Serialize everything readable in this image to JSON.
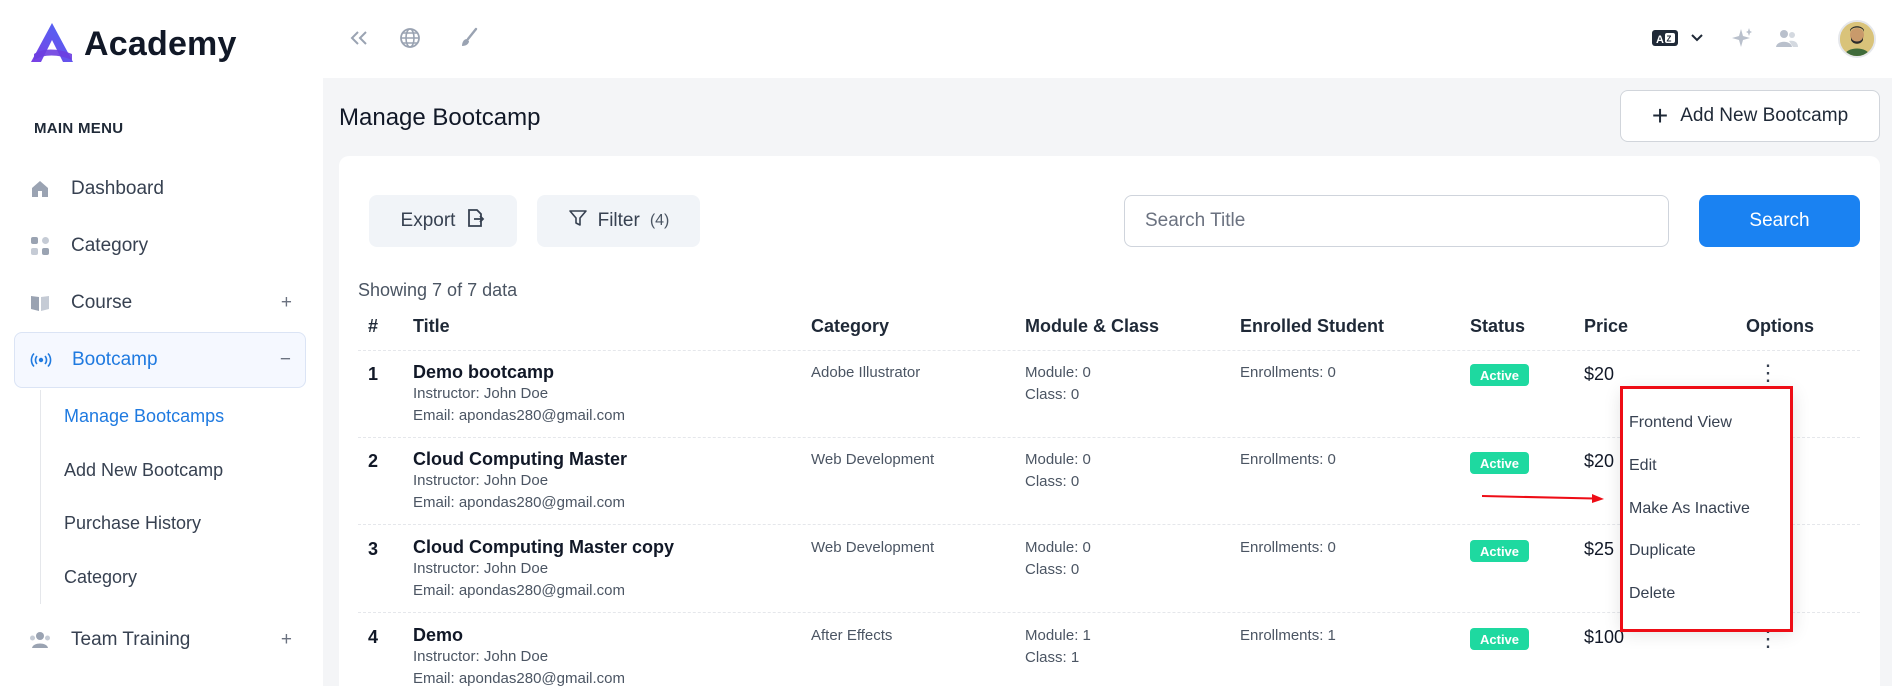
{
  "brand": {
    "name": "Academy"
  },
  "sidebar": {
    "section_label": "MAIN MENU",
    "items": [
      {
        "label": "Dashboard",
        "icon": "home-icon",
        "toggle": ""
      },
      {
        "label": "Category",
        "icon": "grid-icon",
        "toggle": ""
      },
      {
        "label": "Course",
        "icon": "book-icon",
        "toggle": "+"
      },
      {
        "label": "Bootcamp",
        "icon": "broadcast-icon",
        "toggle": "−"
      },
      {
        "label": "Team Training",
        "icon": "team-icon",
        "toggle": "+"
      }
    ],
    "subitems": [
      {
        "label": "Manage Bootcamps"
      },
      {
        "label": "Add New Bootcamp"
      },
      {
        "label": "Purchase History"
      },
      {
        "label": "Category"
      }
    ]
  },
  "topbar": {
    "icons": [
      "collapse-icon",
      "globe-icon",
      "brush-icon",
      "language-icon",
      "chevron-down-icon",
      "sparkle-icon",
      "users-icon"
    ]
  },
  "page": {
    "title": "Manage Bootcamp",
    "add_button": "Add New Bootcamp"
  },
  "toolbar": {
    "export_label": "Export",
    "filter_label": "Filter",
    "filter_count": "(4)",
    "search_placeholder": "Search Title",
    "search_button": "Search"
  },
  "showing": "Showing 7 of 7 data",
  "table": {
    "columns": [
      "#",
      "Title",
      "Category",
      "Module & Class",
      "Enrolled Student",
      "Status",
      "Price",
      "Options"
    ],
    "rows": [
      {
        "num": "1",
        "title": "Demo bootcamp",
        "instructor": "Instructor: John Doe",
        "email": "Email: apondas280@gmail.com",
        "category": "Adobe Illustrator",
        "module": "Module: 0",
        "class": "Class: 0",
        "enrolled": "Enrollments: 0",
        "status": "Active",
        "price": "$20"
      },
      {
        "num": "2",
        "title": "Cloud Computing Master",
        "instructor": "Instructor: John Doe",
        "email": "Email: apondas280@gmail.com",
        "category": "Web Development",
        "module": "Module: 0",
        "class": "Class: 0",
        "enrolled": "Enrollments: 0",
        "status": "Active",
        "price": "$20"
      },
      {
        "num": "3",
        "title": "Cloud Computing Master copy",
        "instructor": "Instructor: John Doe",
        "email": "Email: apondas280@gmail.com",
        "category": "Web Development",
        "module": "Module: 0",
        "class": "Class: 0",
        "enrolled": "Enrollments: 0",
        "status": "Active",
        "price": "$25"
      },
      {
        "num": "4",
        "title": "Demo",
        "instructor": "Instructor: John Doe",
        "email": "Email: apondas280@gmail.com",
        "category": "After Effects",
        "module": "Module: 1",
        "class": "Class: 1",
        "enrolled": "Enrollments: 1",
        "status": "Active",
        "price": "$100"
      }
    ]
  },
  "options_menu": {
    "items": [
      "Frontend View",
      "Edit",
      "Make As Inactive",
      "Duplicate",
      "Delete"
    ]
  },
  "colors": {
    "accent": "#1a82f2",
    "active_badge": "#1ed9a0",
    "annotation_red": "#ee0d16"
  }
}
